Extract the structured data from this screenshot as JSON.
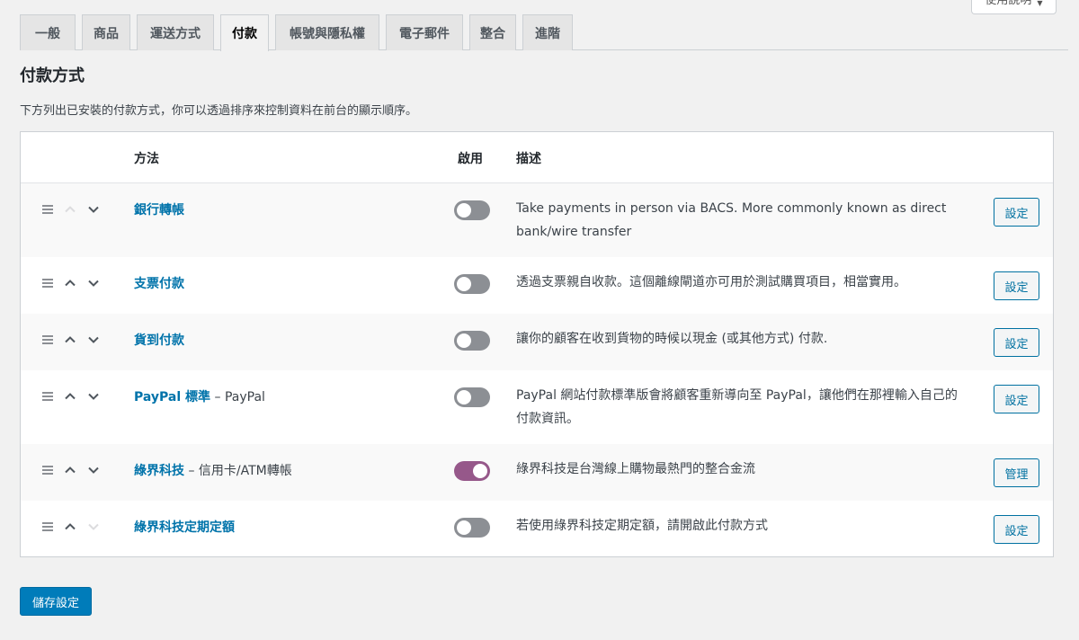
{
  "help": {
    "label": "使用說明",
    "caret": "▼"
  },
  "tabs": [
    {
      "label": "一般",
      "active": false
    },
    {
      "label": "商品",
      "active": false
    },
    {
      "label": "運送方式",
      "active": false
    },
    {
      "label": "付款",
      "active": true
    },
    {
      "label": "帳號與隱私權",
      "active": false
    },
    {
      "label": "電子郵件",
      "active": false
    },
    {
      "label": "整合",
      "active": false
    },
    {
      "label": "進階",
      "active": false
    }
  ],
  "page": {
    "title": "付款方式",
    "intro": "下方列出已安裝的付款方式，你可以透過排序來控制資料在前台的顯示順序。"
  },
  "table": {
    "headers": {
      "method": "方法",
      "enabled": "啟用",
      "description": "描述"
    },
    "rows": [
      {
        "title": "銀行轉帳",
        "subtitle": "",
        "enabled": false,
        "description": "Take payments in person via BACS. More commonly known as direct bank/wire transfer",
        "action": "設定",
        "up_disabled": true,
        "down_disabled": false
      },
      {
        "title": "支票付款",
        "subtitle": "",
        "enabled": false,
        "description": "透過支票親自收款。這個離線閘道亦可用於測試購買項目，相當實用。",
        "action": "設定",
        "up_disabled": false,
        "down_disabled": false
      },
      {
        "title": "貨到付款",
        "subtitle": "",
        "enabled": false,
        "description": "讓你的顧客在收到貨物的時候以現金 (或其他方式) 付款.",
        "action": "設定",
        "up_disabled": false,
        "down_disabled": false
      },
      {
        "title": "PayPal 標準",
        "subtitle": " – PayPal",
        "enabled": false,
        "description": "PayPal 網站付款標準版會將顧客重新導向至 PayPal，讓他們在那裡輸入自己的付款資訊。",
        "action": "設定",
        "up_disabled": false,
        "down_disabled": false
      },
      {
        "title": "綠界科技",
        "subtitle": " – 信用卡/ATM轉帳",
        "enabled": true,
        "description": "綠界科技是台灣線上購物最熱門的整合金流",
        "action": "管理",
        "up_disabled": false,
        "down_disabled": false
      },
      {
        "title": "綠界科技定期定額",
        "subtitle": "",
        "enabled": false,
        "description": "若使用綠界科技定期定額，請開啟此付款方式",
        "action": "設定",
        "up_disabled": false,
        "down_disabled": true
      }
    ]
  },
  "save_label": "儲存設定",
  "colors": {
    "link": "#0073aa",
    "toggle_on": "#96588a",
    "toggle_off": "#8c8f94",
    "primary_button": "#007cba"
  }
}
